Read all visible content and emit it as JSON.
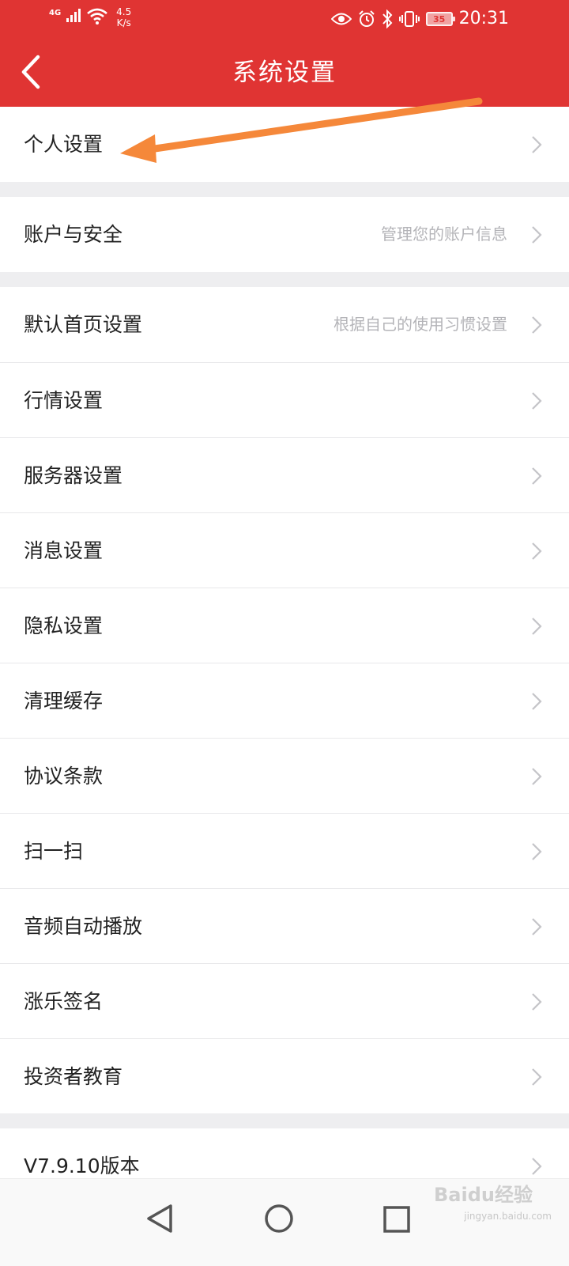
{
  "status_bar": {
    "network": "4G",
    "speed_value": "4.5",
    "speed_unit": "K/s",
    "battery": "35",
    "time": "20:31",
    "icons": [
      "signal-icon",
      "wifi-icon",
      "eye-icon",
      "alarm-icon",
      "bluetooth-icon",
      "vibrate-icon",
      "battery-icon"
    ]
  },
  "header": {
    "title": "系统设置",
    "back_icon": "back-arrow-icon",
    "color": "#e03433"
  },
  "groups": [
    [
      {
        "label": "个人设置",
        "hint": ""
      }
    ],
    [
      {
        "label": "账户与安全",
        "hint": "管理您的账户信息"
      }
    ],
    [
      {
        "label": "默认首页设置",
        "hint": "根据自己的使用习惯设置"
      },
      {
        "label": "行情设置",
        "hint": ""
      },
      {
        "label": "服务器设置",
        "hint": ""
      },
      {
        "label": "消息设置",
        "hint": ""
      },
      {
        "label": "隐私设置",
        "hint": ""
      },
      {
        "label": "清理缓存",
        "hint": ""
      },
      {
        "label": "协议条款",
        "hint": ""
      },
      {
        "label": "扫一扫",
        "hint": ""
      },
      {
        "label": "音频自动播放",
        "hint": ""
      },
      {
        "label": "涨乐签名",
        "hint": ""
      },
      {
        "label": "投资者教育",
        "hint": ""
      }
    ],
    [
      {
        "label": "V7.9.10版本",
        "hint": ""
      }
    ]
  ],
  "nav_bar": {
    "icons": [
      "nav-back-icon",
      "nav-home-icon",
      "nav-recents-icon"
    ]
  },
  "watermark": {
    "text": "Baidu经验",
    "sub": "jingyan.baidu.com"
  },
  "annotation": {
    "arrow_color": "#f5883a"
  }
}
